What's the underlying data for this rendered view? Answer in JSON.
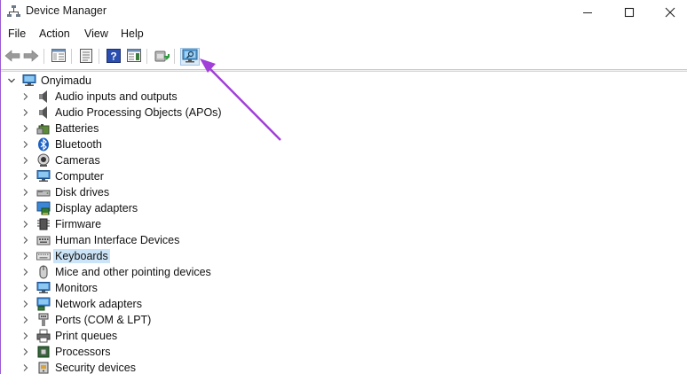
{
  "window": {
    "title": "Device Manager"
  },
  "menu": [
    "File",
    "Action",
    "View",
    "Help"
  ],
  "toolbar": {
    "buttons": [
      "back-icon",
      "forward-icon",
      "show-hide-tree-icon",
      "properties-icon",
      "help-icon",
      "console-view-icon",
      "update-driver-icon",
      "scan-hardware-changes-icon"
    ],
    "highlighted": "scan-hardware-changes-icon"
  },
  "tree": {
    "root": "Onyimadu",
    "categories": [
      {
        "label": "Audio inputs and outputs",
        "icon": "speaker-icon"
      },
      {
        "label": "Audio Processing Objects (APOs)",
        "icon": "speaker-icon"
      },
      {
        "label": "Batteries",
        "icon": "battery-icon"
      },
      {
        "label": "Bluetooth",
        "icon": "bluetooth-icon"
      },
      {
        "label": "Cameras",
        "icon": "camera-icon"
      },
      {
        "label": "Computer",
        "icon": "monitor-icon"
      },
      {
        "label": "Disk drives",
        "icon": "disk-icon"
      },
      {
        "label": "Display adapters",
        "icon": "display-adapter-icon"
      },
      {
        "label": "Firmware",
        "icon": "chip-icon"
      },
      {
        "label": "Human Interface Devices",
        "icon": "hid-icon"
      },
      {
        "label": "Keyboards",
        "icon": "keyboard-icon",
        "selected": true
      },
      {
        "label": "Mice and other pointing devices",
        "icon": "mouse-icon"
      },
      {
        "label": "Monitors",
        "icon": "monitor-icon"
      },
      {
        "label": "Network adapters",
        "icon": "network-icon"
      },
      {
        "label": "Ports (COM & LPT)",
        "icon": "port-icon"
      },
      {
        "label": "Print queues",
        "icon": "printer-icon"
      },
      {
        "label": "Processors",
        "icon": "processor-icon"
      },
      {
        "label": "Security devices",
        "icon": "security-icon"
      }
    ]
  },
  "annotation": {
    "color": "#a13fd9"
  }
}
